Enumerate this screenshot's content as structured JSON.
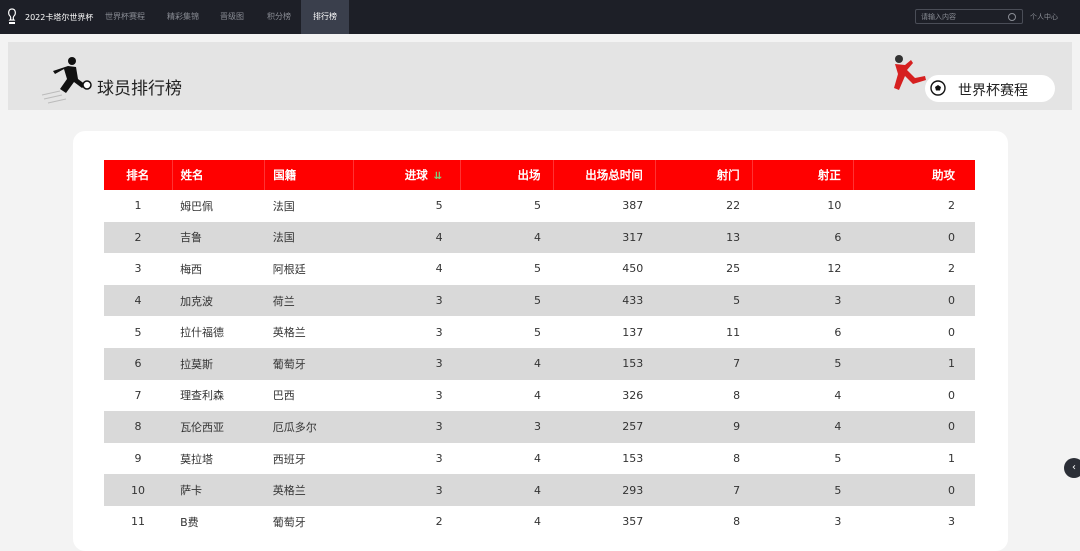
{
  "app": {
    "brand": "2022卡塔尔世界杯"
  },
  "nav": {
    "items": [
      {
        "label": "世界杯赛程"
      },
      {
        "label": "精彩集锦"
      },
      {
        "label": "晋级图"
      },
      {
        "label": "积分榜"
      },
      {
        "label": "排行榜"
      }
    ],
    "active": "排行榜"
  },
  "search": {
    "placeholder": "请输入内容"
  },
  "user": {
    "label": "个人中心"
  },
  "banner": {
    "title": "球员排行榜",
    "button_label": "世界杯赛程"
  },
  "table": {
    "headers": [
      "排名",
      "姓名",
      "国籍",
      "进球",
      "出场",
      "出场总时间",
      "射门",
      "射正",
      "助攻"
    ],
    "rows": [
      [
        "1",
        "姆巴佩",
        "法国",
        "5",
        "5",
        "387",
        "22",
        "10",
        "2"
      ],
      [
        "2",
        "吉鲁",
        "法国",
        "4",
        "4",
        "317",
        "13",
        "6",
        "0"
      ],
      [
        "3",
        "梅西",
        "阿根廷",
        "4",
        "5",
        "450",
        "25",
        "12",
        "2"
      ],
      [
        "4",
        "加克波",
        "荷兰",
        "3",
        "5",
        "433",
        "5",
        "3",
        "0"
      ],
      [
        "5",
        "拉什福德",
        "英格兰",
        "3",
        "5",
        "137",
        "11",
        "6",
        "0"
      ],
      [
        "6",
        "拉莫斯",
        "葡萄牙",
        "3",
        "4",
        "153",
        "7",
        "5",
        "1"
      ],
      [
        "7",
        "理查利森",
        "巴西",
        "3",
        "4",
        "326",
        "8",
        "4",
        "0"
      ],
      [
        "8",
        "瓦伦西亚",
        "厄瓜多尔",
        "3",
        "3",
        "257",
        "9",
        "4",
        "0"
      ],
      [
        "9",
        "莫拉塔",
        "西班牙",
        "3",
        "4",
        "153",
        "8",
        "5",
        "1"
      ],
      [
        "10",
        "萨卡",
        "英格兰",
        "3",
        "4",
        "293",
        "7",
        "5",
        "0"
      ],
      [
        "11",
        "B费",
        "葡萄牙",
        "2",
        "4",
        "357",
        "8",
        "3",
        "3"
      ]
    ]
  },
  "icons": {
    "sort": "sort-desc-icon",
    "logo": "trophy-icon",
    "collapse": "chevron-left-icon"
  },
  "colors": {
    "header_red": "#ff0000",
    "nav_bg": "#1d1f27",
    "zebra": "#d9d9d9"
  }
}
